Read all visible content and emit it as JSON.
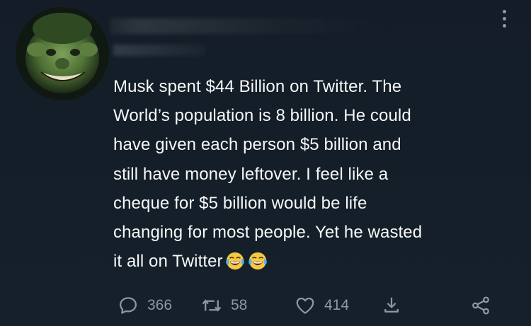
{
  "tweet": {
    "body_lines": [
      "Musk spent $44 Billion on Twitter.   The",
      "World’s population is 8 billion.   He could",
      "have given each person $5 billion and",
      "still have money leftover.  I feel like a",
      "cheque for $5 billion would be life",
      "changing for most people. Yet he wasted",
      "it all on Twitter"
    ],
    "emoji": [
      "face-with-tears-of-joy",
      "face-with-tears-of-joy"
    ]
  },
  "actions": {
    "reply_count": "366",
    "retweet_count": "58",
    "like_count": "414"
  },
  "icons": {
    "more": "more-vertical-icon",
    "reply": "reply-icon",
    "retweet": "retweet-icon",
    "like": "heart-icon",
    "bookmark": "bookmark-icon",
    "share": "share-icon"
  },
  "colors": {
    "background": "#15202b",
    "text": "#f7f9f9",
    "secondary": "#8b98a5"
  }
}
